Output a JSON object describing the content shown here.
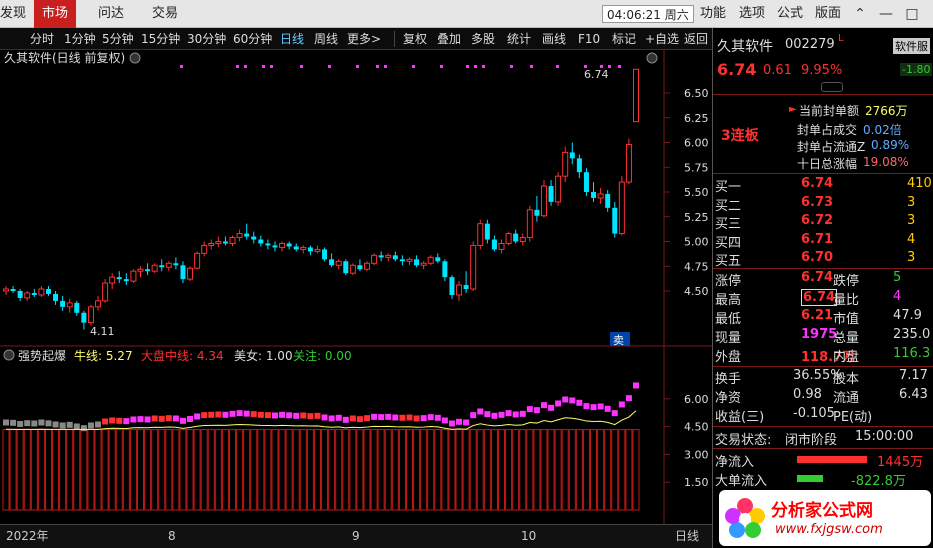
{
  "nav": {
    "partial": "发现",
    "market": "市场",
    "ask": "问达",
    "trade": "交易"
  },
  "clock": "04:06:21 周六",
  "menu": {
    "func": "功能",
    "option": "选项",
    "formula": "公式",
    "layout": "版面"
  },
  "toolbar": {
    "periods": [
      "分时",
      "1分钟",
      "5分钟",
      "15分钟",
      "30分钟",
      "60分钟",
      "日线",
      "周线",
      "更多>"
    ],
    "actions": [
      "复权",
      "叠加",
      "多股",
      "统计",
      "画线",
      "F10",
      "标记",
      "+自选",
      "返回"
    ]
  },
  "chart": {
    "stock_title": "久其软件(日线 前复权)",
    "high_label": "6.74",
    "low_label": "4.11",
    "sell_marker": "卖",
    "price_ticks": [
      "6.50",
      "6.25",
      "6.00",
      "5.75",
      "5.50",
      "5.25",
      "5.00",
      "4.75",
      "4.50"
    ],
    "indicator_ticks": [
      "6.00",
      "4.50",
      "3.00",
      "1.50"
    ],
    "indicator": {
      "name": "强势起爆",
      "l1": "牛线: 5.27",
      "l2": "大盘中线: 4.34",
      "l3": "美女: 1.00",
      "l4": "关注: 0.00"
    },
    "dates": [
      "2022年",
      "8",
      "9",
      "10"
    ],
    "period_label": "日线"
  },
  "chart_data": {
    "type": "candlestick",
    "series": [
      {
        "name": "price",
        "values": [
          [
            4.5,
            4.55,
            4.46,
            4.52
          ],
          [
            4.52,
            4.55,
            4.48,
            4.5
          ],
          [
            4.5,
            4.52,
            4.4,
            4.43
          ],
          [
            4.43,
            4.5,
            4.4,
            4.48
          ],
          [
            4.48,
            4.52,
            4.44,
            4.46
          ],
          [
            4.46,
            4.55,
            4.44,
            4.52
          ],
          [
            4.52,
            4.55,
            4.45,
            4.47
          ],
          [
            4.47,
            4.5,
            4.36,
            4.4
          ],
          [
            4.4,
            4.45,
            4.3,
            4.34
          ],
          [
            4.34,
            4.42,
            4.28,
            4.38
          ],
          [
            4.38,
            4.4,
            4.25,
            4.28
          ],
          [
            4.28,
            4.3,
            4.11,
            4.18
          ],
          [
            4.18,
            4.36,
            4.15,
            4.34
          ],
          [
            4.34,
            4.45,
            4.3,
            4.4
          ],
          [
            4.4,
            4.62,
            4.38,
            4.58
          ],
          [
            4.58,
            4.68,
            4.52,
            4.64
          ],
          [
            4.64,
            4.7,
            4.58,
            4.62
          ],
          [
            4.62,
            4.68,
            4.56,
            4.6
          ],
          [
            4.6,
            4.72,
            4.58,
            4.7
          ],
          [
            4.7,
            4.75,
            4.64,
            4.72
          ],
          [
            4.72,
            4.78,
            4.66,
            4.7
          ],
          [
            4.7,
            4.78,
            4.68,
            4.76
          ],
          [
            4.76,
            4.82,
            4.7,
            4.74
          ],
          [
            4.74,
            4.8,
            4.7,
            4.78
          ],
          [
            4.78,
            4.84,
            4.72,
            4.76
          ],
          [
            4.76,
            4.8,
            4.58,
            4.62
          ],
          [
            4.62,
            4.75,
            4.6,
            4.73
          ],
          [
            4.73,
            4.9,
            4.72,
            4.88
          ],
          [
            4.88,
            5.0,
            4.85,
            4.96
          ],
          [
            4.96,
            5.02,
            4.92,
            4.98
          ],
          [
            4.98,
            5.05,
            4.94,
            5.0
          ],
          [
            5.0,
            5.05,
            4.96,
            4.98
          ],
          [
            4.98,
            5.06,
            4.95,
            5.04
          ],
          [
            5.04,
            5.12,
            5.0,
            5.08
          ],
          [
            5.08,
            5.18,
            5.02,
            5.05
          ],
          [
            5.05,
            5.1,
            4.98,
            5.02
          ],
          [
            5.02,
            5.06,
            4.95,
            4.98
          ],
          [
            4.98,
            5.02,
            4.92,
            4.96
          ],
          [
            4.96,
            5.0,
            4.9,
            4.94
          ],
          [
            4.94,
            5.0,
            4.9,
            4.98
          ],
          [
            4.98,
            5.0,
            4.92,
            4.95
          ],
          [
            4.95,
            4.98,
            4.9,
            4.92
          ],
          [
            4.92,
            4.96,
            4.88,
            4.94
          ],
          [
            4.94,
            4.96,
            4.86,
            4.9
          ],
          [
            4.9,
            4.96,
            4.88,
            4.92
          ],
          [
            4.92,
            4.94,
            4.8,
            4.82
          ],
          [
            4.82,
            4.88,
            4.74,
            4.76
          ],
          [
            4.76,
            4.82,
            4.72,
            4.8
          ],
          [
            4.8,
            4.82,
            4.66,
            4.68
          ],
          [
            4.68,
            4.78,
            4.66,
            4.76
          ],
          [
            4.76,
            4.82,
            4.7,
            4.72
          ],
          [
            4.72,
            4.8,
            4.7,
            4.78
          ],
          [
            4.78,
            4.88,
            4.76,
            4.86
          ],
          [
            4.86,
            4.9,
            4.8,
            4.84
          ],
          [
            4.84,
            4.88,
            4.8,
            4.86
          ],
          [
            4.86,
            4.9,
            4.8,
            4.82
          ],
          [
            4.82,
            4.86,
            4.76,
            4.8
          ],
          [
            4.8,
            4.84,
            4.76,
            4.82
          ],
          [
            4.82,
            4.86,
            4.74,
            4.76
          ],
          [
            4.76,
            4.8,
            4.72,
            4.78
          ],
          [
            4.78,
            4.86,
            4.76,
            4.84
          ],
          [
            4.84,
            4.88,
            4.78,
            4.8
          ],
          [
            4.8,
            4.82,
            4.6,
            4.64
          ],
          [
            4.64,
            4.66,
            4.42,
            4.46
          ],
          [
            4.46,
            4.6,
            4.4,
            4.56
          ],
          [
            4.56,
            4.7,
            4.48,
            4.52
          ],
          [
            4.52,
            5.0,
            4.5,
            4.96
          ],
          [
            4.96,
            5.22,
            4.92,
            5.18
          ],
          [
            5.18,
            5.22,
            4.98,
            5.02
          ],
          [
            5.02,
            5.06,
            4.9,
            4.92
          ],
          [
            4.92,
            5.02,
            4.88,
            4.98
          ],
          [
            4.98,
            5.1,
            4.96,
            5.08
          ],
          [
            5.08,
            5.12,
            4.98,
            5.0
          ],
          [
            5.0,
            5.08,
            4.96,
            5.04
          ],
          [
            5.04,
            5.36,
            5.0,
            5.32
          ],
          [
            5.32,
            5.46,
            5.2,
            5.26
          ],
          [
            5.26,
            5.62,
            5.24,
            5.56
          ],
          [
            5.56,
            5.62,
            5.36,
            5.4
          ],
          [
            5.4,
            5.7,
            5.36,
            5.66
          ],
          [
            5.66,
            5.96,
            5.6,
            5.9
          ],
          [
            5.9,
            6.0,
            5.78,
            5.84
          ],
          [
            5.84,
            5.88,
            5.64,
            5.7
          ],
          [
            5.7,
            5.74,
            5.46,
            5.5
          ],
          [
            5.5,
            5.6,
            5.4,
            5.44
          ],
          [
            5.44,
            5.54,
            5.38,
            5.48
          ],
          [
            5.48,
            5.52,
            5.3,
            5.34
          ],
          [
            5.34,
            5.4,
            5.04,
            5.08
          ],
          [
            5.08,
            5.66,
            5.06,
            5.6
          ],
          [
            5.6,
            6.04,
            5.58,
            5.98
          ],
          [
            6.21,
            6.74,
            6.21,
            6.74
          ]
        ]
      }
    ],
    "ylim": [
      4.11,
      6.74
    ],
    "indicator": {
      "type": "bar",
      "ylim": [
        0,
        6.8
      ]
    }
  },
  "right": {
    "name": "久其软件",
    "code": "002279",
    "price": "6.74",
    "change": "0.61",
    "pct": "9.95%",
    "side_label": "软件服",
    "side_pct": "-1.80",
    "seal_title": "当前封单额",
    "seal_val": "2766万",
    "tag": "3连板",
    "stats": [
      [
        "封单占成交",
        "0.02倍"
      ],
      [
        "封单占流通Z",
        "0.89%"
      ],
      [
        "十日总涨幅",
        "19.08%"
      ]
    ],
    "bids": [
      [
        "买一",
        "6.74",
        "410"
      ],
      [
        "买二",
        "6.73",
        "3"
      ],
      [
        "买三",
        "6.72",
        "3"
      ],
      [
        "买四",
        "6.71",
        "4"
      ],
      [
        "买五",
        "6.70",
        "3"
      ]
    ],
    "q": [
      [
        "涨停",
        "6.74",
        "跌停",
        "5"
      ],
      [
        "最高",
        "6.74",
        "量比",
        "4"
      ],
      [
        "最低",
        "6.21",
        "市值",
        "47.9"
      ],
      [
        "现量",
        "1975",
        "总量",
        "235.0"
      ],
      [
        "外盘",
        "118.7万",
        "内盘",
        "116.3"
      ]
    ],
    "q2": [
      [
        "换手",
        "36.55%",
        "股本",
        "7.17"
      ],
      [
        "净资",
        "0.98",
        "流通",
        "6.43"
      ],
      [
        "收益(三)",
        "-0.105",
        "PE(动)",
        ""
      ]
    ],
    "status_label": "交易状态:",
    "status_val": "闭市阶段",
    "status_time": "15:00:00",
    "net_in_label": "净流入",
    "net_in_val": "1445万",
    "big_in_label": "大单流入",
    "big_in_val": "-822.8万",
    "watermark_brand": "分析家公式网",
    "watermark_url": "www.fxjgsw.com"
  },
  "colors": {
    "up": "#ff3030",
    "down": "#00e5ff",
    "magenta": "#ff33ff",
    "yellow": "#ffff66",
    "green": "#33cc33"
  }
}
